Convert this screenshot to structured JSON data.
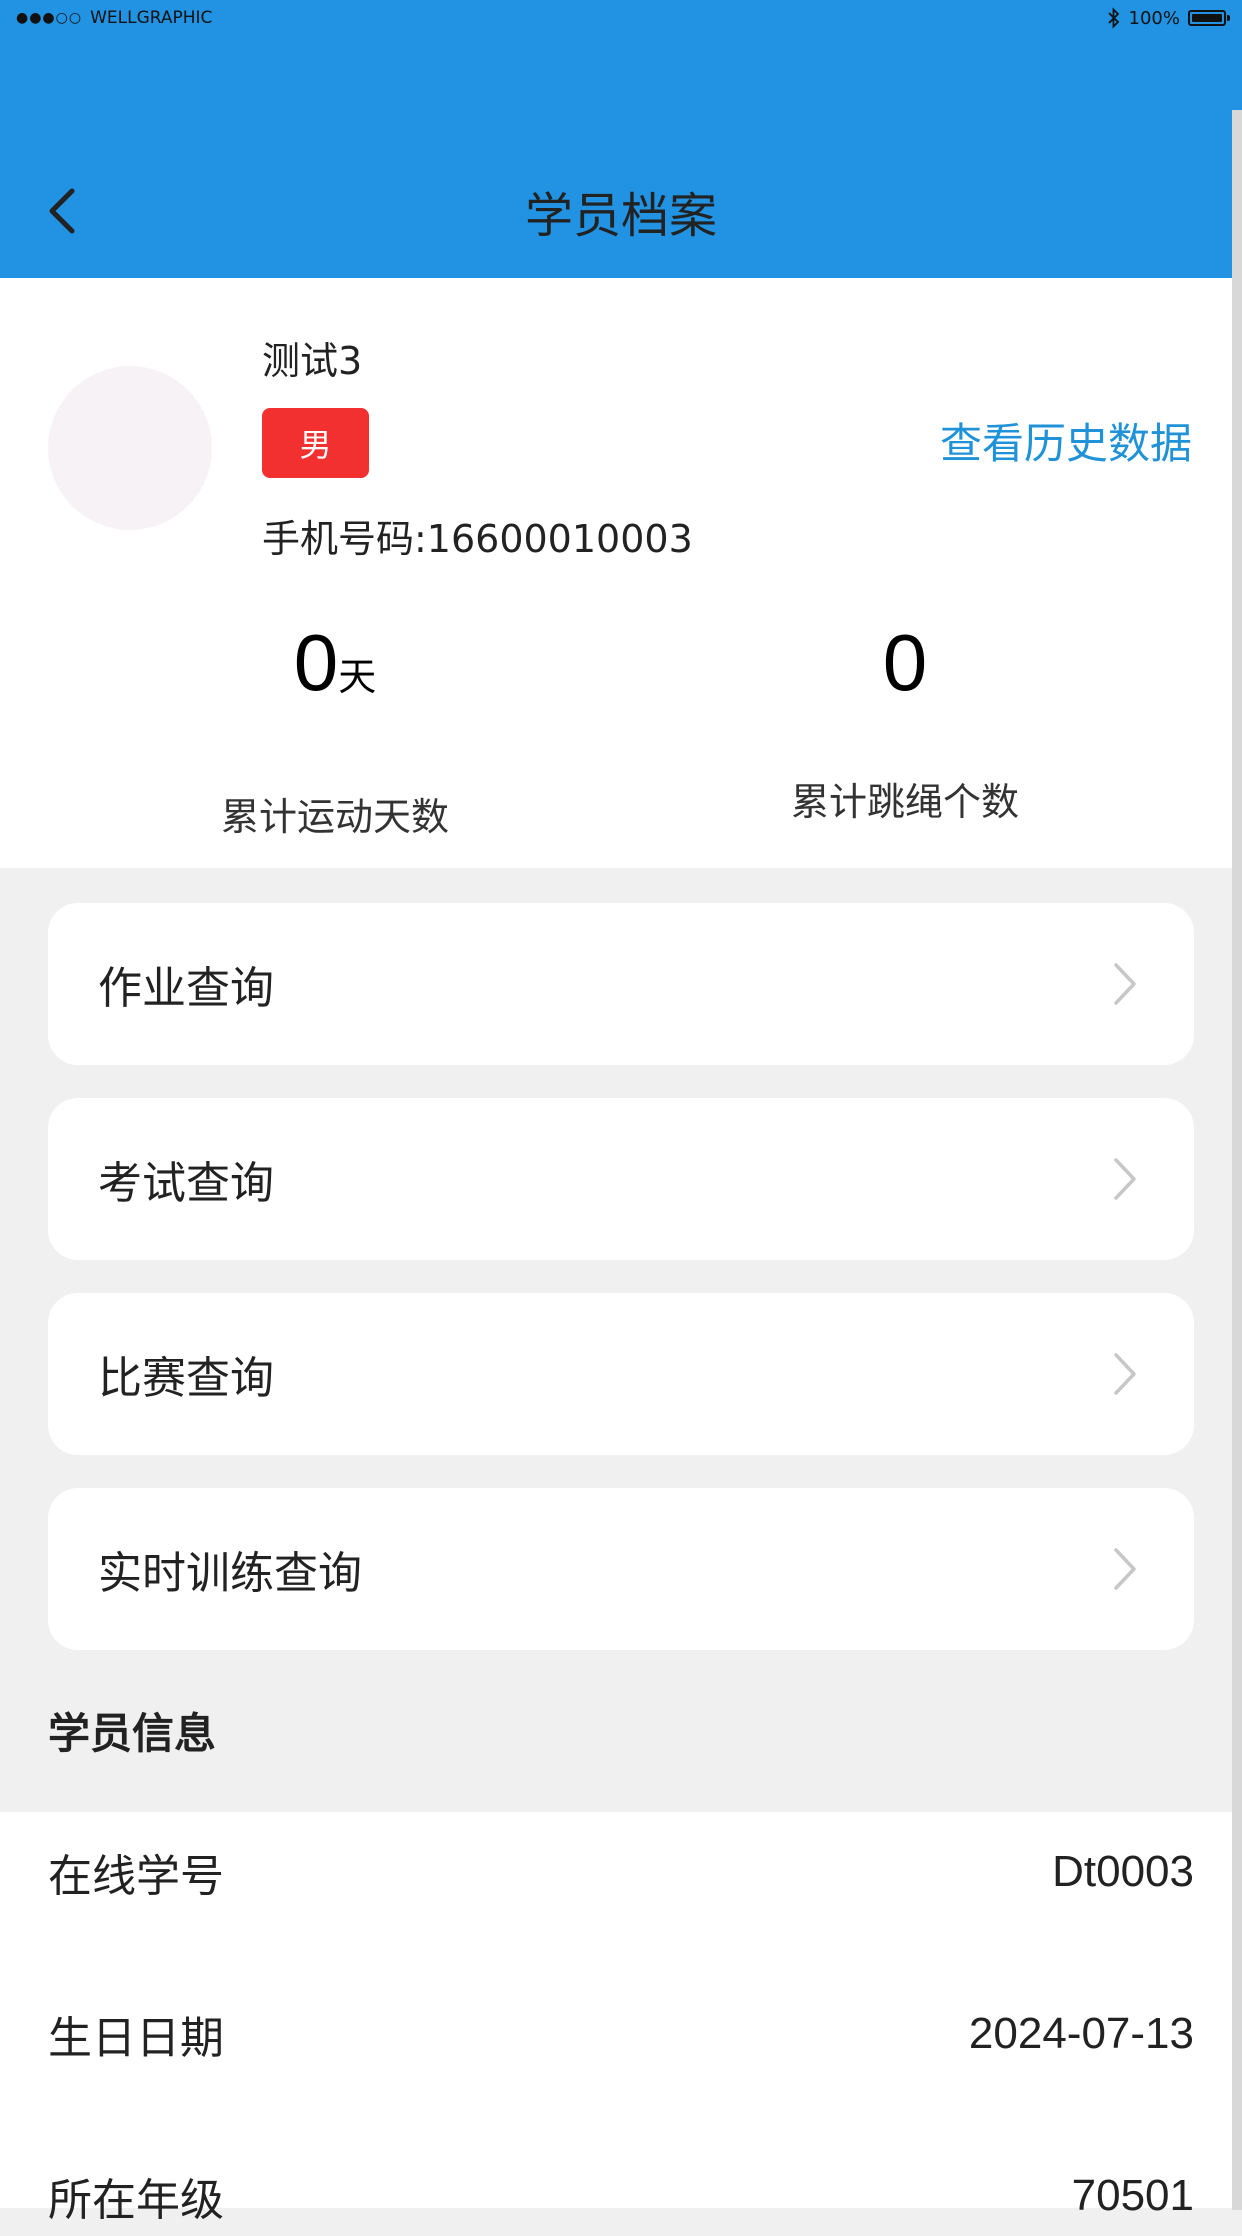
{
  "status_bar": {
    "signal": "●●●○○",
    "carrier": "WELLGRAPHIC",
    "battery": "100%",
    "bluetooth_icon": "bluetooth-icon"
  },
  "nav": {
    "title": "学员档案",
    "back_icon": "chevron-left-icon"
  },
  "profile": {
    "name": "测试3",
    "gender": "男",
    "phone": "手机号码:16600010003",
    "history_link": "查看历史数据"
  },
  "stats": [
    {
      "value": "0",
      "unit": "天",
      "label": "累计运动天数"
    },
    {
      "value": "0",
      "unit": "",
      "label": "累计跳绳个数"
    }
  ],
  "menu": [
    {
      "label": "作业查询"
    },
    {
      "label": "考试查询"
    },
    {
      "label": "比赛查询"
    },
    {
      "label": "实时训练查询"
    }
  ],
  "student_info": {
    "title": "学员信息",
    "rows": [
      {
        "label": "在线学号",
        "value": "Dt0003"
      },
      {
        "label": "生日日期",
        "value": "2024-07-13"
      },
      {
        "label": "所在年级",
        "value": "70501"
      }
    ]
  },
  "colors": {
    "header": "#2193e2",
    "badge": "#f23030",
    "link": "#2093d8"
  }
}
